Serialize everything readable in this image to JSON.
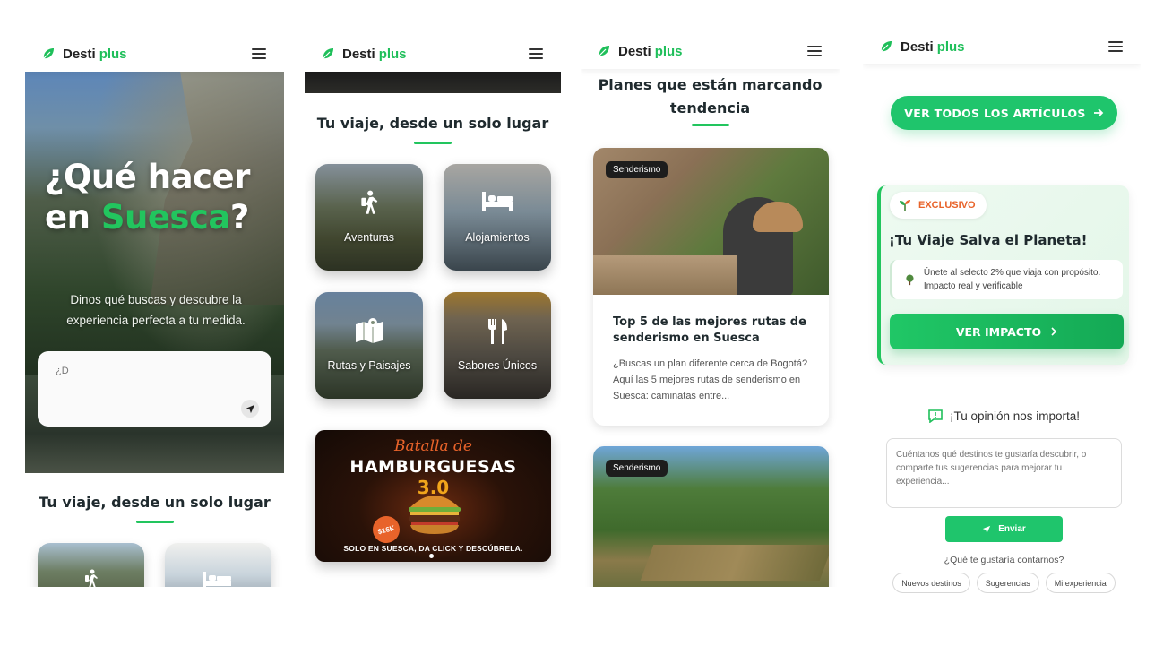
{
  "brand": {
    "name": "Desti",
    "name_accent": "plus",
    "accent_color": "#1fbf5a",
    "logo_icon": "leaf-icon"
  },
  "screen1": {
    "hero_title_line1": "¿Qué hacer",
    "hero_title_en": "en",
    "hero_title_place": "Suesca",
    "hero_title_end": "?",
    "hero_subtitle": "Dinos qué buscas y descubre la experiencia perfecta a tu medida.",
    "search_placeholder": "¿D",
    "section_title": "Tu viaje, desde un solo lugar"
  },
  "screen2": {
    "section_title": "Tu viaje, desde un solo lugar",
    "tiles": [
      {
        "label": "Aventuras",
        "icon": "hiking-icon"
      },
      {
        "label": "Alojamientos",
        "icon": "bed-icon"
      },
      {
        "label": "Rutas y Paisajes",
        "icon": "map-icon"
      },
      {
        "label": "Sabores Únicos",
        "icon": "utensils-icon"
      }
    ],
    "banner": {
      "script_text": "Batalla de",
      "title": "HAMBURGUESAS",
      "edition": "3.0",
      "price": "$16K",
      "cta": "SOLO EN SUESCA, DA CLICK Y DESCÚBRELA."
    }
  },
  "screen3": {
    "title": "Planes que están marcando tendencia",
    "articles": [
      {
        "tag": "Senderismo",
        "title": "Top 5 de las mejores rutas de senderismo en Suesca",
        "excerpt": "¿Buscas un plan diferente cerca de Bogotá? Aquí las 5 mejores rutas de senderismo en Suesca: caminatas entre..."
      },
      {
        "tag": "Senderismo"
      }
    ]
  },
  "screen4": {
    "view_all_label": "VER TODOS LOS ARTÍCULOS",
    "promo": {
      "badge": "EXCLUSIVO",
      "title": "¡Tu Viaje Salva el Planeta!",
      "note": "Únete al selecto 2% que viaja con propósito. Impacto real y verificable",
      "cta": "VER IMPACTO"
    },
    "feedback": {
      "heading": "¡Tu opinión nos importa!",
      "placeholder": "Cuéntanos qué destinos te gustaría descubrir, o comparte tus sugerencias para mejorar tu experiencia...",
      "send_label": "Enviar",
      "question": "¿Qué te gustaría contarnos?",
      "chips": [
        "Nuevos destinos",
        "Sugerencias",
        "Mi experiencia"
      ]
    }
  },
  "colors": {
    "green": "#22c55e",
    "button_green": "#1fc56c",
    "orange": "#e8632a",
    "text_dark": "#1f2a2e"
  }
}
